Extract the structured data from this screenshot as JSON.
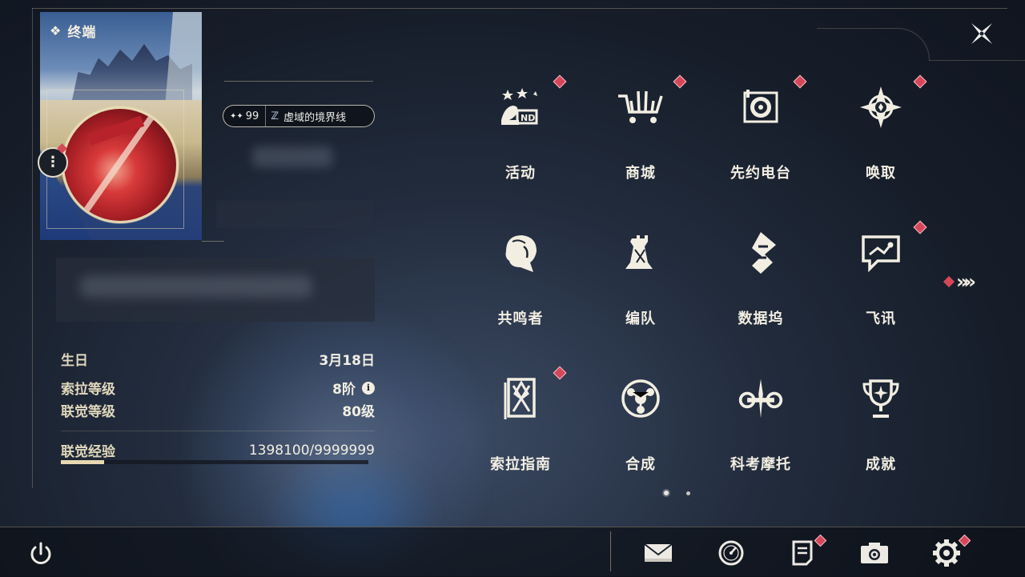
{
  "header": {
    "title": "终端",
    "glyph": "❖"
  },
  "profile": {
    "level_prefix": "✦✦",
    "level": "99",
    "signature_glyph": "ℤ",
    "signature": "虚域的境界线",
    "more_glyph": "⋮"
  },
  "stats": [
    {
      "label": "生日",
      "value": "3月18日"
    },
    {
      "label": "索拉等级",
      "value": "8阶",
      "info": "i"
    },
    {
      "label": "联觉等级",
      "value": "80级"
    },
    {
      "label": "联觉经验",
      "value": "1398100/9999999",
      "progress": 0.1398
    }
  ],
  "menu": [
    {
      "label": "活动",
      "icon": "event-2nd-icon",
      "alert": true
    },
    {
      "label": "商城",
      "icon": "shopping-cart-icon",
      "alert": true
    },
    {
      "label": "先约电台",
      "icon": "radio-icon",
      "alert": true
    },
    {
      "label": "唤取",
      "icon": "compass-star-icon",
      "alert": true
    },
    {
      "label": "共鸣者",
      "icon": "character-profile-icon",
      "alert": false
    },
    {
      "label": "编队",
      "icon": "chess-pieces-icon",
      "alert": false
    },
    {
      "label": "数据坞",
      "icon": "data-dock-icon",
      "alert": false
    },
    {
      "label": "飞讯",
      "icon": "chat-bubble-icon",
      "alert": true
    },
    {
      "label": "索拉指南",
      "icon": "guide-book-icon",
      "alert": true
    },
    {
      "label": "合成",
      "icon": "synthesis-icon",
      "alert": false
    },
    {
      "label": "科考摩托",
      "icon": "motorcycle-icon",
      "alert": false
    },
    {
      "label": "成就",
      "icon": "trophy-icon",
      "alert": false
    }
  ],
  "pager": {
    "pages": 2,
    "current": 1
  },
  "next_glyph": "»",
  "bottom_icons": [
    "mail-icon",
    "clock-icon",
    "notice-icon",
    "camera-icon",
    "settings-gear-icon"
  ],
  "colors": {
    "alert": "#d6465a",
    "accent": "#e7d7b3",
    "text": "#f2eee2"
  }
}
